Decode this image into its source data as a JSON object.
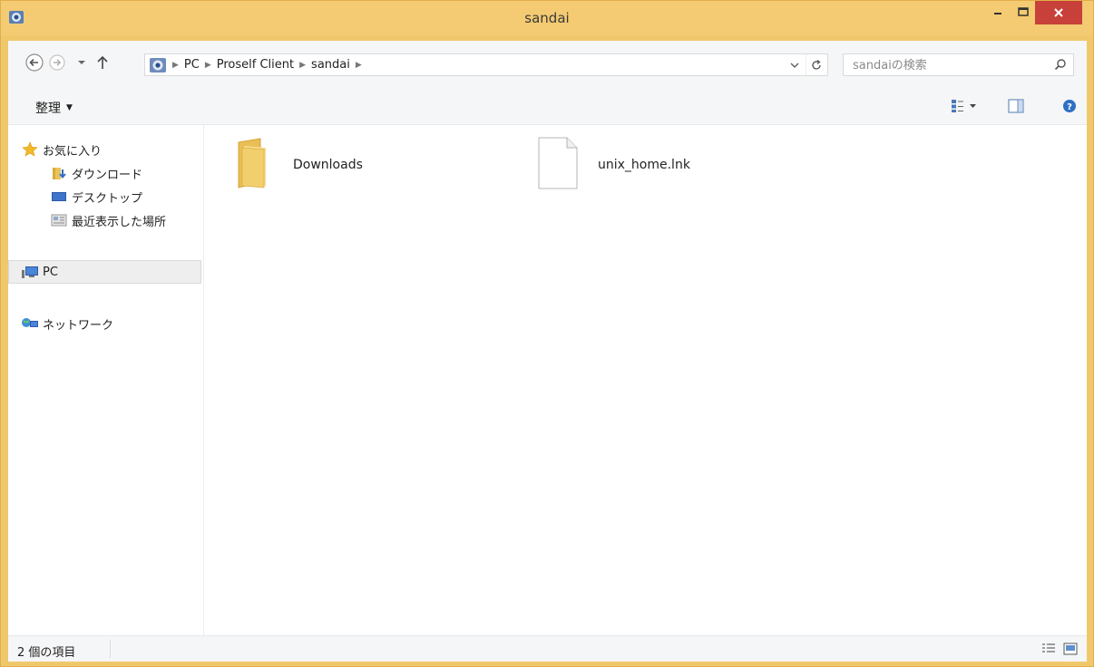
{
  "window": {
    "title": "sandai"
  },
  "address_bar": {
    "breadcrumbs": [
      "PC",
      "Proself Client",
      "sandai"
    ],
    "search_placeholder": "sandaiの検索"
  },
  "command_bar": {
    "organize_label": "整理"
  },
  "nav_pane": {
    "favorites_label": "お気に入り",
    "favorites_items": [
      "ダウンロード",
      "デスクトップ",
      "最近表示した場所"
    ],
    "pc_label": "PC",
    "network_label": "ネットワーク"
  },
  "files": [
    {
      "name": "Downloads",
      "type": "folder"
    },
    {
      "name": "unix_home.lnk",
      "type": "file"
    }
  ],
  "status_bar": {
    "item_count": "2 個の項目"
  },
  "colors": {
    "title_bar": "#f4cb72",
    "close_button": "#c7403a",
    "folder": "#f2cf6d"
  }
}
